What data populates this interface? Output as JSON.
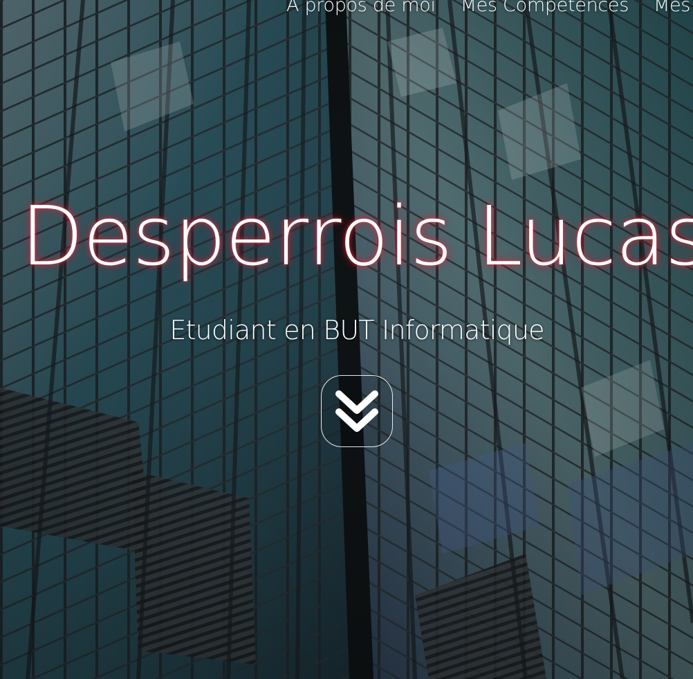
{
  "nav": {
    "items": [
      "A propos de moi",
      "Mes Compétences",
      "Mes"
    ]
  },
  "hero": {
    "title": "Desperrois Lucas",
    "subtitle": "Etudiant en BUT Informatique",
    "scroll_icon": "double-chevron-down-icon",
    "background": "glass-skyscraper-facade-photo"
  },
  "colors": {
    "text": "#ffffff",
    "title_glow": "#ff2a3c",
    "facade_dark": "#1f2d35",
    "facade_teal": "#2f5a66"
  }
}
